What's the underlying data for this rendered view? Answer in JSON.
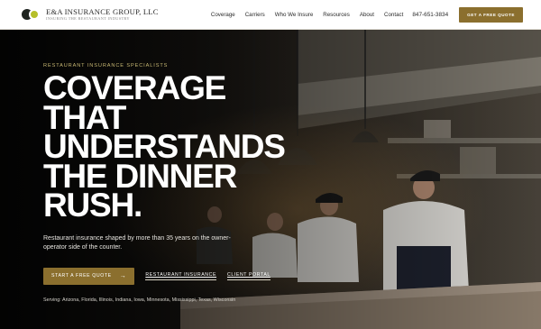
{
  "brand": {
    "name": "E&A INSURANCE GROUP, LLC",
    "tagline": "INSURING THE RESTAURANT INDUSTRY",
    "colors": {
      "accent": "#8b6f2e",
      "logo_green": "#b5bf2a",
      "eyebrow": "#c8b873"
    }
  },
  "nav": {
    "items": [
      "Coverage",
      "Carriers",
      "Who We Insure",
      "Resources",
      "About",
      "Contact"
    ],
    "phone": "847-651-3834",
    "cta_label": "GET A FREE QUOTE"
  },
  "hero": {
    "eyebrow": "RESTAURANT INSURANCE SPECIALISTS",
    "headline": "COVERAGE THAT UNDERSTANDS THE DINNER RUSH.",
    "subtext": "Restaurant insurance shaped by more than 35 years on the owner-operator side of the counter.",
    "primary_cta": "START A FREE QUOTE",
    "primary_cta_icon": "arrow-right-icon",
    "secondary_ctas": [
      "RESTAURANT INSURANCE",
      "CLIENT PORTAL"
    ],
    "serving": "Serving: Arizona, Florida, Illinois, Indiana, Iowa, Minnesota, Mississippi, Texas, Wisconsin",
    "background_image": "restaurant kitchen with chefs working at the line"
  }
}
